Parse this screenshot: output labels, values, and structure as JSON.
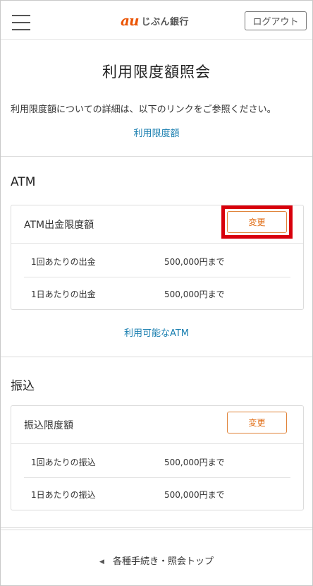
{
  "header": {
    "logo_au": "au",
    "logo_text": "じぶん銀行",
    "logout_label": "ログアウト",
    "menu_icon": "hamburger-menu-icon"
  },
  "page": {
    "title": "利用限度額照会",
    "intro": "利用限度額についての詳細は、以下のリンクをご参照ください。",
    "limit_link": "利用限度額"
  },
  "atm": {
    "section_title": "ATM",
    "card_title": "ATM出金限度額",
    "change_label": "変更",
    "rows": [
      {
        "label": "1回あたりの出金",
        "value": "500,000円まで"
      },
      {
        "label": "1日あたりの出金",
        "value": "500,000円まで"
      }
    ],
    "available_link": "利用可能なATM"
  },
  "transfer": {
    "section_title": "振込",
    "card_title": "振込限度額",
    "change_label": "変更",
    "rows": [
      {
        "label": "1回あたりの振込",
        "value": "500,000円まで"
      },
      {
        "label": "1日あたりの振込",
        "value": "500,000円まで"
      }
    ]
  },
  "footer": {
    "back_label": "各種手続き・照会トップ",
    "back_icon": "triangle-left-icon"
  },
  "colors": {
    "brand": "#eb5505",
    "link": "#1a7fb0",
    "button_border": "#e0843a",
    "highlight": "#d8000b"
  }
}
